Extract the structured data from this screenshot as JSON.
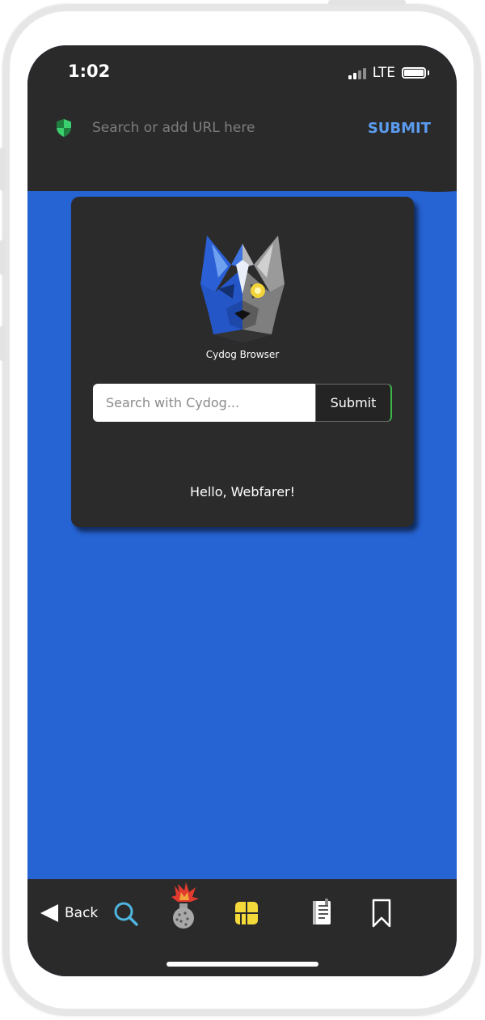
{
  "status": {
    "time": "1:02",
    "network": "LTE"
  },
  "url_bar": {
    "placeholder": "Search or add URL here",
    "submit_label": "SUBMIT"
  },
  "card": {
    "logo_caption": "Cydog Browser",
    "search_placeholder": "Search with Cydog...",
    "search_submit_label": "Submit",
    "greeting": "Hello, Webfarer!"
  },
  "bottom_nav": {
    "back_label": "Back",
    "icons": [
      "search-icon",
      "bomb-icon",
      "tabs-grid-icon",
      "notebook-icon",
      "bookmark-icon"
    ]
  },
  "colors": {
    "background_blue": "#2663d3",
    "bar_dark": "#2a2a2a",
    "accent_submit": "#5b9cf0",
    "shield_green": "#3ccf6e",
    "search_icon_cyan": "#4fb6e0",
    "tabs_icon_yellow": "#f4d93a"
  }
}
